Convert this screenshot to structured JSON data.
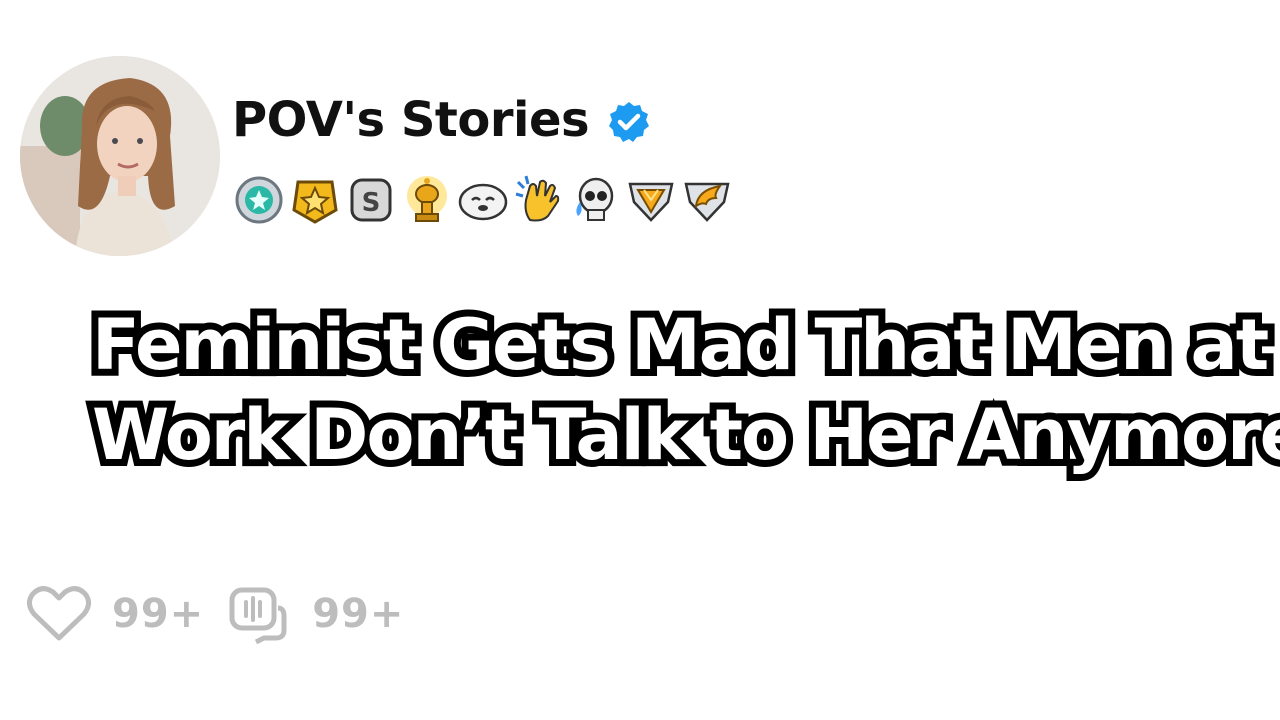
{
  "channel": {
    "name": "POV's Stories",
    "verified_color": "#1d9bf0",
    "badges": [
      "helpful-medal-icon",
      "star-badge-icon",
      "s-coin-icon",
      "gold-trophy-icon",
      "smiling-seal-icon",
      "high-five-icon",
      "crying-skull-icon",
      "gold-gem-shield-icon",
      "gold-wing-shield-icon"
    ]
  },
  "post": {
    "title_line1": "Feminist Gets Mad That Men at",
    "title_line2": "Work Don’t Talk to Her Anymore"
  },
  "stats": {
    "likes": "99+",
    "comments": "99+",
    "color": "#bdbdbd"
  }
}
